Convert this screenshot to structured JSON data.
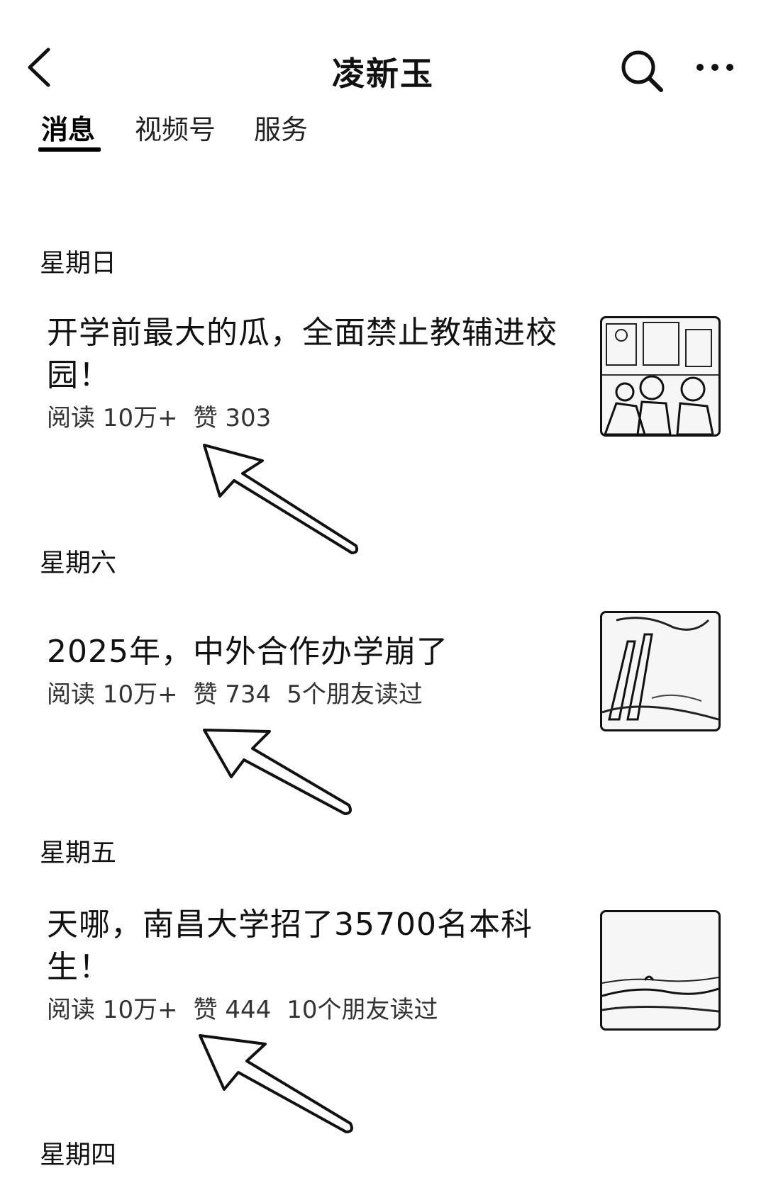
{
  "header": {
    "title": "凌新玉",
    "back_icon": "chevron-left-icon",
    "search_icon": "search-icon",
    "more_icon": "more-horizontal-icon"
  },
  "tabs": [
    {
      "label": "消息",
      "active": true
    },
    {
      "label": "视频号",
      "active": false
    },
    {
      "label": "服务",
      "active": false
    }
  ],
  "feed": [
    {
      "day": "星期日",
      "title": "开学前最大的瓜，全面禁止教辅进校园！",
      "reads": "阅读 10万+",
      "likes": "赞 303",
      "friends": ""
    },
    {
      "day": "星期六",
      "title": "2025年，中外合作办学崩了",
      "reads": "阅读 10万+",
      "likes": "赞 734",
      "friends": "5个朋友读过"
    },
    {
      "day": "星期五",
      "title": "天哪，南昌大学招了35700名本科生！",
      "reads": "阅读 10万+",
      "likes": "赞 444",
      "friends": "10个朋友读过"
    },
    {
      "day": "星期四"
    }
  ]
}
